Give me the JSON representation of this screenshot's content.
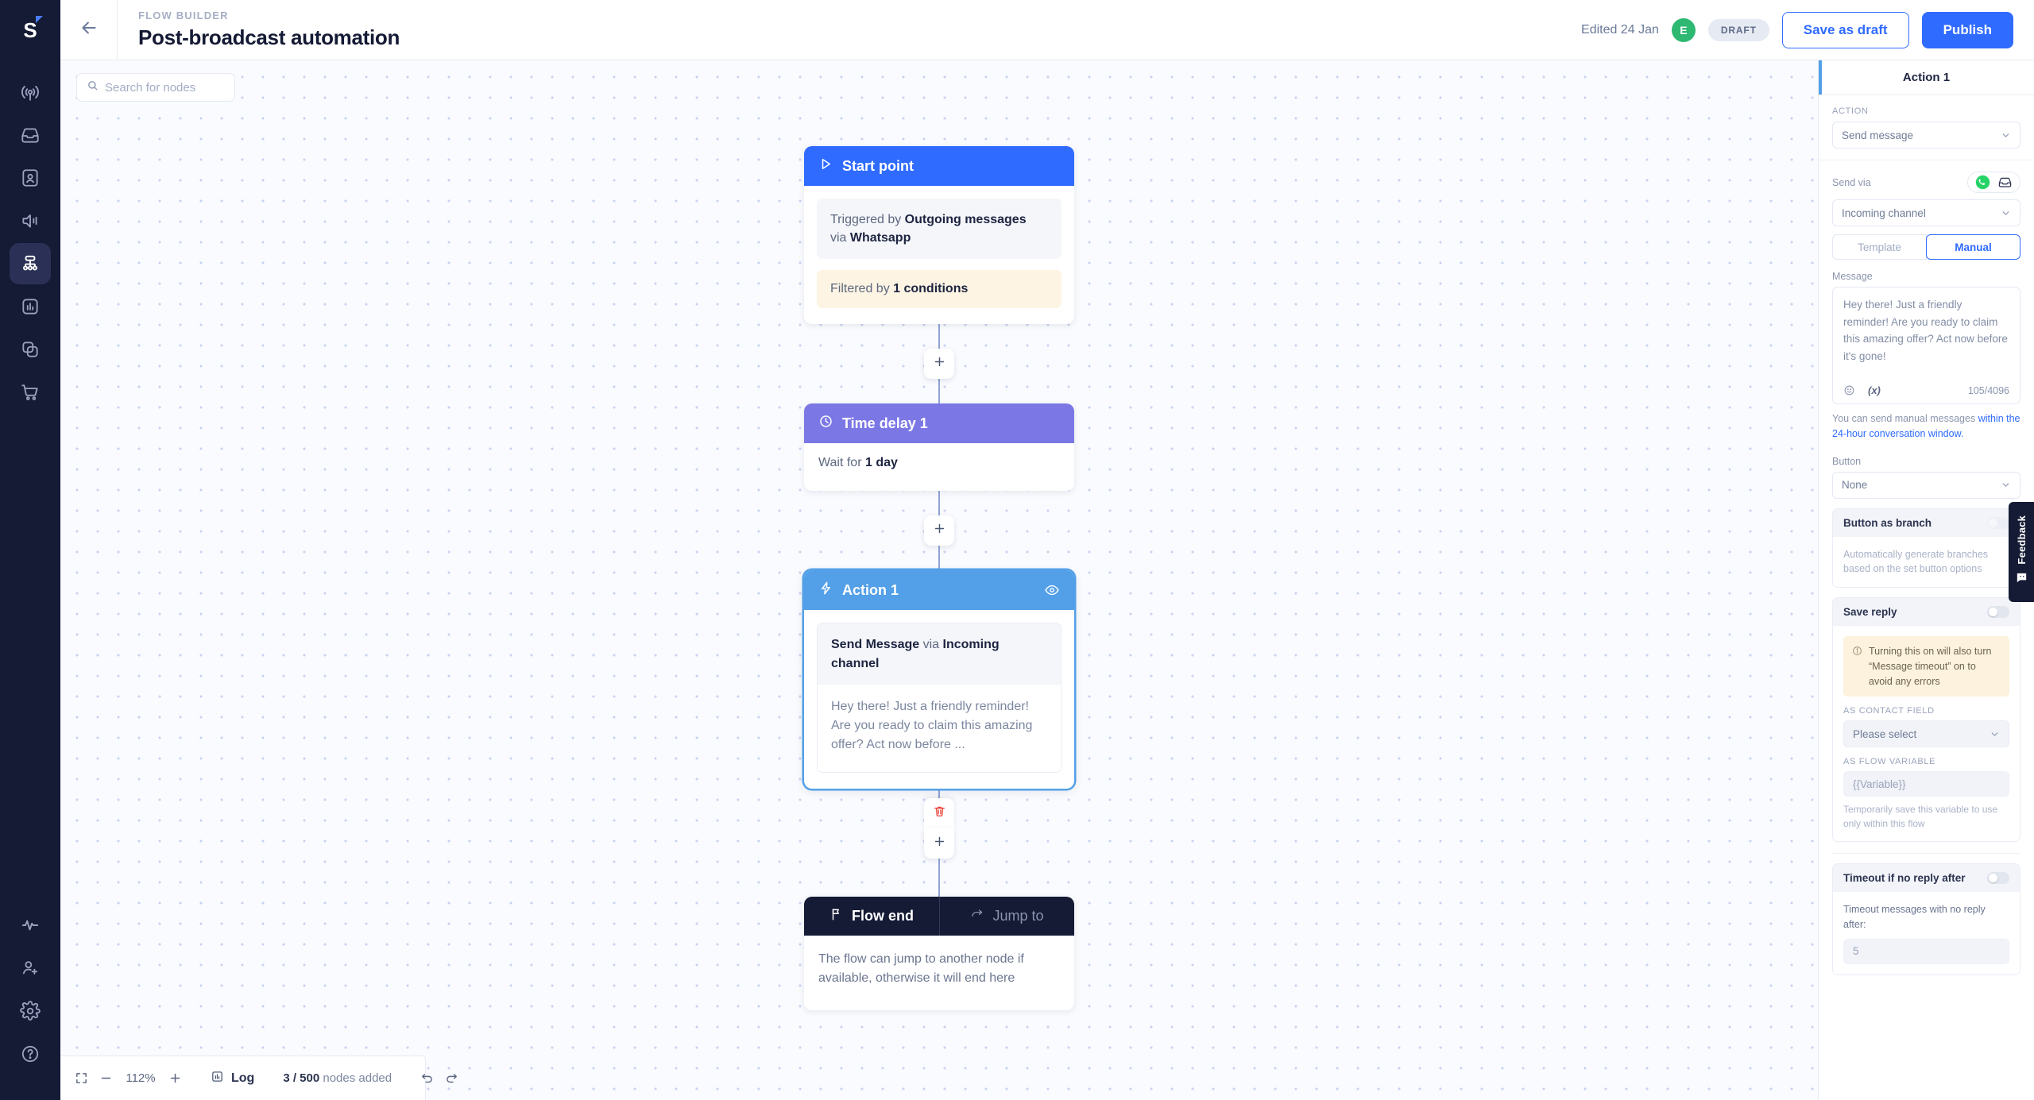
{
  "rail": {
    "logo_text": "S",
    "items": [
      {
        "name": "broadcast-icon",
        "label": "Broadcast",
        "active": false
      },
      {
        "name": "inbox-icon",
        "label": "Inbox",
        "active": false
      },
      {
        "name": "contacts-icon",
        "label": "Contacts",
        "active": false
      },
      {
        "name": "campaign-icon",
        "label": "Campaigns",
        "active": false
      },
      {
        "name": "flow-builder-icon",
        "label": "Flow Builder",
        "active": true
      },
      {
        "name": "analytics-icon",
        "label": "Analytics",
        "active": false
      },
      {
        "name": "integrations-icon",
        "label": "Integrations",
        "active": false
      },
      {
        "name": "commerce-icon",
        "label": "Commerce",
        "active": false
      }
    ],
    "bottom_items": [
      {
        "name": "activity-icon",
        "label": "Activity"
      },
      {
        "name": "add-user-icon",
        "label": "Invite"
      },
      {
        "name": "gear-icon",
        "label": "Settings"
      },
      {
        "name": "help-icon",
        "label": "Help"
      }
    ]
  },
  "header": {
    "back_label": "Back",
    "eyebrow": "FLOW BUILDER",
    "title": "Post-broadcast automation",
    "edited": "Edited 24 Jan",
    "avatar_initial": "E",
    "status_chip": "DRAFT",
    "save_draft_label": "Save as draft",
    "publish_label": "Publish"
  },
  "canvas": {
    "search_placeholder": "Search for nodes",
    "nodes": {
      "start": {
        "title": "Start point",
        "trigger_prefix": "Triggered by ",
        "trigger_value": "Outgoing messages",
        "trigger_via_prefix": "via ",
        "trigger_via_value": "Whatsapp",
        "filter_prefix": "Filtered by ",
        "filter_value": "1 conditions"
      },
      "delay": {
        "title": "Time delay 1",
        "wait_prefix": "Wait for ",
        "wait_value": "1 day"
      },
      "action": {
        "title": "Action 1",
        "summary_action": "Send Message",
        "summary_mid": " via ",
        "summary_channel": "Incoming channel",
        "preview": "Hey there! Just a friendly reminder! Are you ready to claim this amazing offer? Act now before ..."
      },
      "end": {
        "tab_flow_end": "Flow end",
        "tab_jump_to": "Jump to",
        "description": "The flow can jump to another node if available, otherwise it will end here"
      }
    }
  },
  "bottombar": {
    "fit_label": "Fit to screen",
    "zoom_out_label": "Zoom out",
    "zoom_value": "112%",
    "zoom_in_label": "Zoom in",
    "log_label": "Log",
    "nodes_count": "3 / 500",
    "nodes_suffix": " nodes added",
    "undo_label": "Undo",
    "redo_label": "Redo"
  },
  "panel": {
    "title": "Action 1",
    "action_label": "ACTION",
    "action_value": "Send message",
    "send_via_label": "Send via",
    "channel_value": "Incoming channel",
    "tab_template": "Template",
    "tab_manual": "Manual",
    "message_label": "Message",
    "message_value": "Hey there! Just a friendly reminder! Are you ready to claim this amazing offer? Act now before it's gone!",
    "var_glyph": "(x)",
    "counter": "105/4096",
    "hint_prefix": "You can send manual messages ",
    "hint_link": "within the 24-hour conversation window.",
    "button_label": "Button",
    "button_value": "None",
    "branch_title": "Button as branch",
    "branch_sub": "Automatically generate branches based on the set button options",
    "save_reply_title": "Save reply",
    "save_reply_warn": "Turning this on will also turn “Message timeout” on to avoid any errors",
    "contact_field_label": "AS CONTACT FIELD",
    "contact_field_value": "Please select",
    "flow_var_label": "AS FLOW VARIABLE",
    "flow_var_placeholder": "{{Variable}}",
    "flow_var_note": "Temporarily save this variable to use only within this flow",
    "timeout_title": "Timeout if no reply after",
    "timeout_sub": "Timeout messages with no reply after:",
    "timeout_value": "5"
  },
  "feedback": {
    "label": "Feedback"
  },
  "colors": {
    "brand_blue": "#2f6bff",
    "start_node": "#2f6bff",
    "delay_node": "#7b78e5",
    "action_node": "#53a0e8",
    "dark_navy": "#151a35",
    "green_avatar": "#2eb872",
    "amber_bg": "#fdf4e3",
    "danger_red": "#e8453c"
  }
}
